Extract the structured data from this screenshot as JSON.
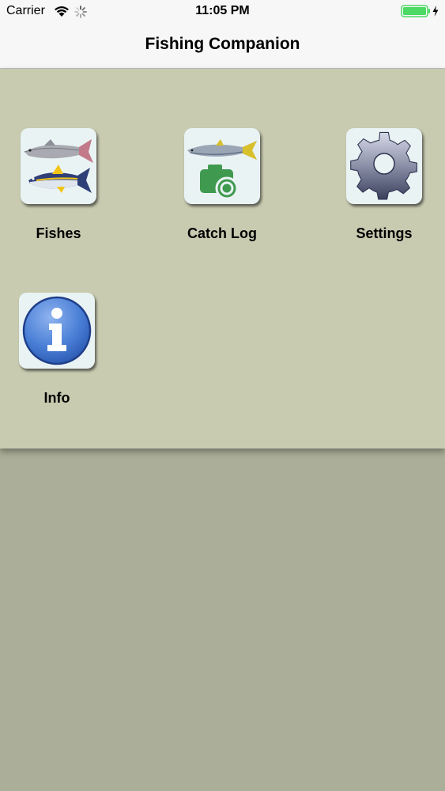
{
  "status_bar": {
    "carrier": "Carrier",
    "time": "11:05 PM",
    "icons": [
      "wifi-icon",
      "activity-spinner-icon",
      "battery-charging-icon"
    ]
  },
  "nav": {
    "title": "Fishing Companion"
  },
  "menu": {
    "items": [
      {
        "label": "Fishes",
        "icon": "fishes-icon"
      },
      {
        "label": "Catch Log",
        "icon": "catch-log-camera-icon"
      },
      {
        "label": "Settings",
        "icon": "gear-icon"
      },
      {
        "label": "Info",
        "icon": "info-icon"
      }
    ]
  },
  "colors": {
    "panel": "#c8cbb0",
    "background": "#abae98",
    "battery_green": "#4cd964",
    "camera_green": "#3f9a4f",
    "info_blue": "#3a6fd0"
  }
}
